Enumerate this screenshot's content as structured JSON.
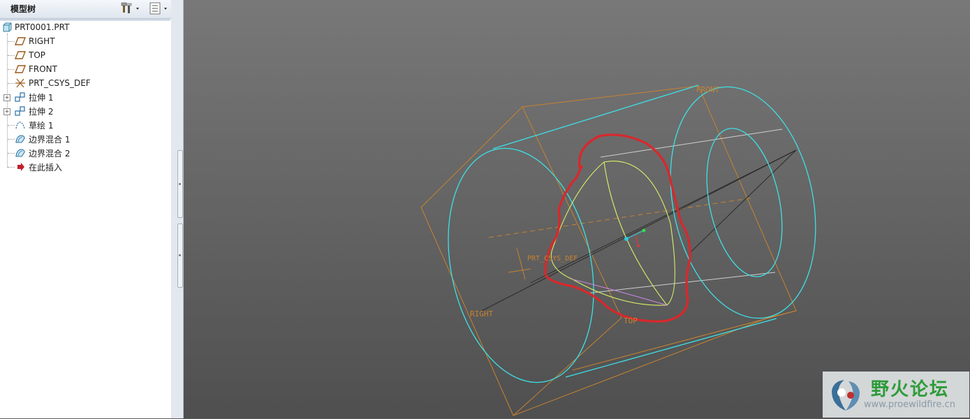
{
  "panel": {
    "title": "模型树"
  },
  "tree": {
    "items": [
      {
        "label": "PRT0001.PRT"
      },
      {
        "label": "RIGHT"
      },
      {
        "label": "TOP"
      },
      {
        "label": "FRONT"
      },
      {
        "label": "PRT_CSYS_DEF"
      },
      {
        "label": "拉伸 1"
      },
      {
        "label": "拉伸 2"
      },
      {
        "label": "草绘 1"
      },
      {
        "label": "边界混合 1"
      },
      {
        "label": "边界混合 2"
      },
      {
        "label": "在此插入"
      }
    ]
  },
  "viewport": {
    "labels": {
      "front": "FRONT",
      "right": "RIGHT",
      "top": "TOP",
      "csys": "PRT_CSYS_DEF"
    }
  },
  "watermark": {
    "title": "野火论坛",
    "url": "www.proewildfire.cn"
  },
  "colors": {
    "datum": "#c7832f",
    "cylinder": "#3ee0e6",
    "surface": "#d7f06a",
    "markup": "#d8282c"
  }
}
